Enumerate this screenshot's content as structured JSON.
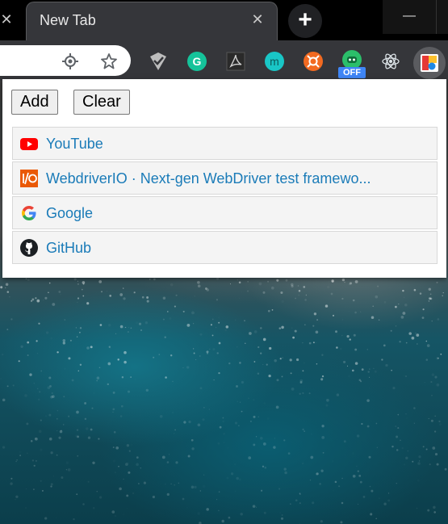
{
  "tab": {
    "title": "New Tab",
    "close_glyph": "✕",
    "partial_close_glyph": "✕",
    "new_tab_glyph": "+"
  },
  "window": {
    "minimize_glyph": "—"
  },
  "toolbar": {
    "icons": [
      "location-icon",
      "bookmark-star-icon"
    ],
    "extensions": [
      "shield-check-extension-icon",
      "grammarly-extension-icon",
      "pdf-extension-icon",
      "m-extension-icon",
      "orange-lifebuoy-extension-icon",
      "android-extension-icon",
      "react-extension-icon",
      "bookmarks-extension-icon"
    ],
    "off_badge": "OFF"
  },
  "popup": {
    "add_label": "Add",
    "clear_label": "Clear",
    "items": [
      {
        "label": "YouTube",
        "icon": "youtube-icon"
      },
      {
        "label": "WebdriverIO · Next-gen WebDriver test framewo...",
        "icon": "webdriverio-icon"
      },
      {
        "label": "Google",
        "icon": "google-icon"
      },
      {
        "label": "GitHub",
        "icon": "github-icon"
      }
    ]
  },
  "colors": {
    "link": "#1a7bb8",
    "tab_bg": "#35363a",
    "badge": "#3f86f6"
  }
}
